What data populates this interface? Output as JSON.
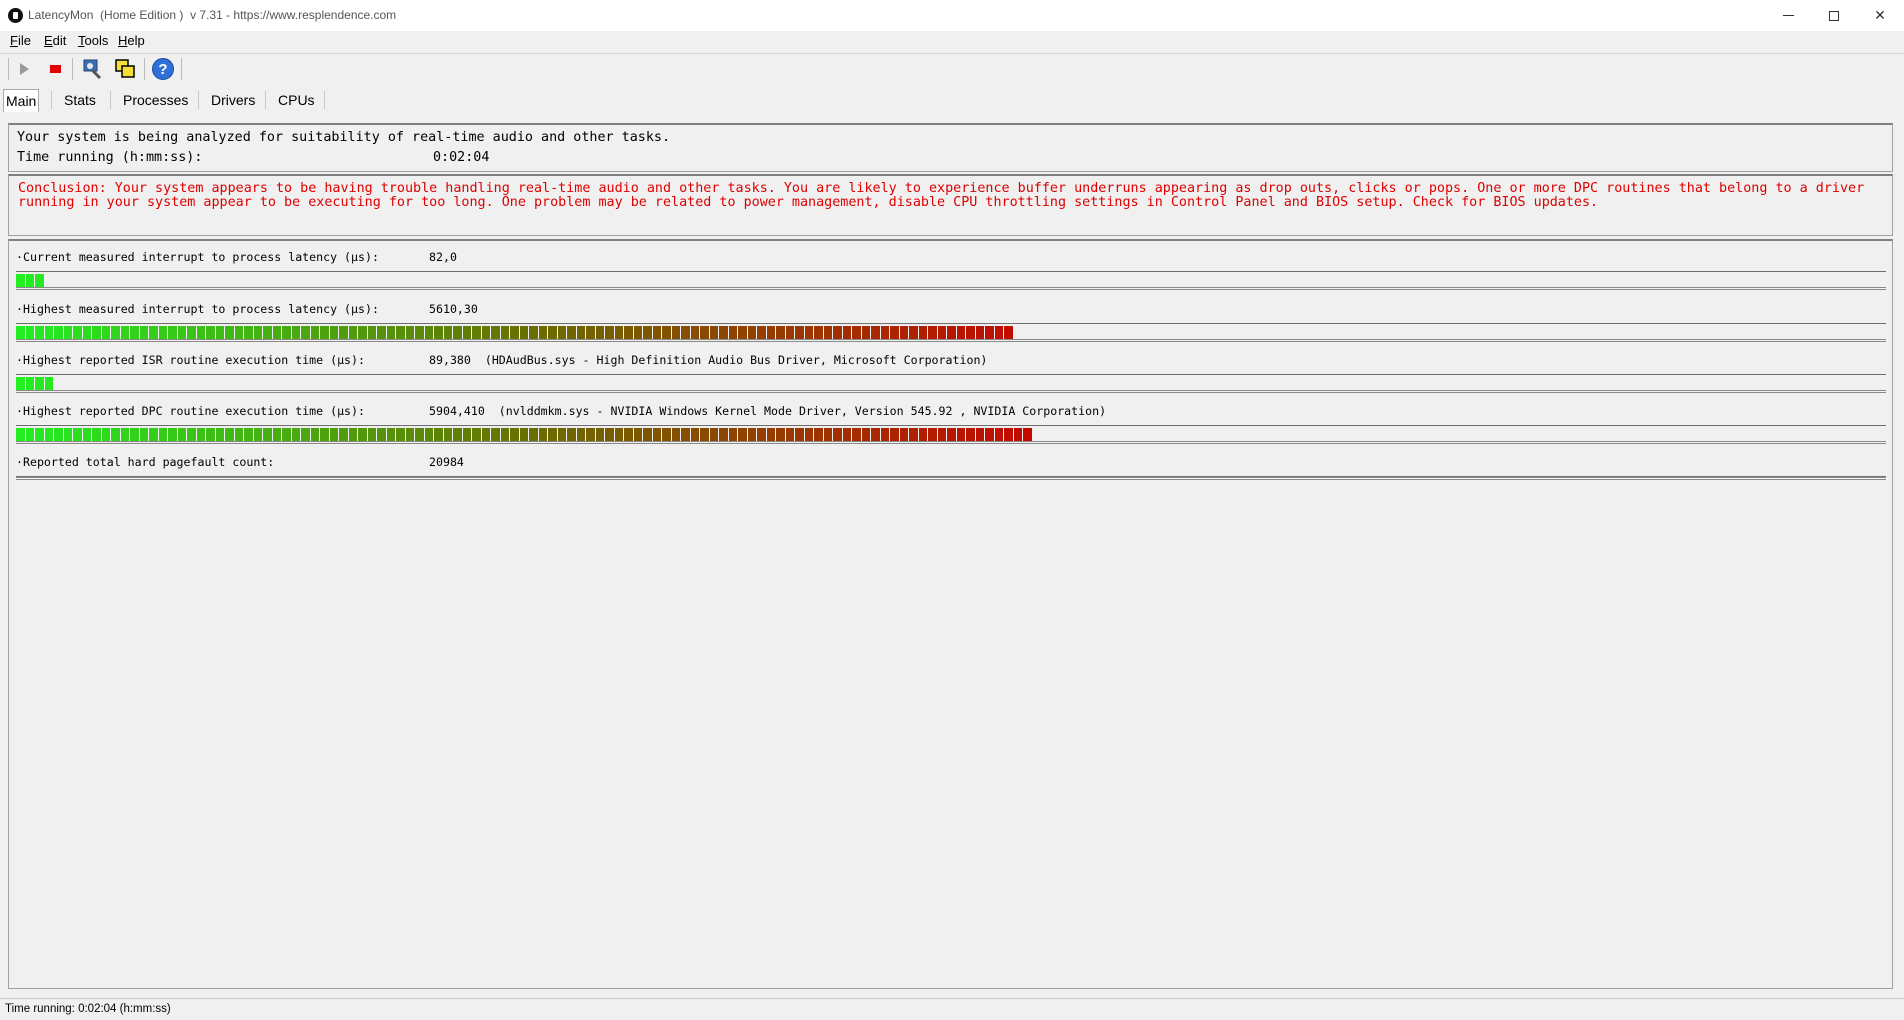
{
  "window": {
    "title": "LatencyMon  (Home Edition )  v 7.31 - https://www.resplendence.com"
  },
  "menu": {
    "items": [
      {
        "label": "File",
        "key": "F",
        "rest": "ile"
      },
      {
        "label": "Edit",
        "key": "E",
        "rest": "dit"
      },
      {
        "label": "Tools",
        "key": "T",
        "rest": "ools"
      },
      {
        "label": "Help",
        "key": "H",
        "rest": "elp"
      }
    ]
  },
  "toolbar": {
    "icons": [
      "play-icon",
      "stop-icon",
      "analyze-icon",
      "windows-icon",
      "help-icon"
    ]
  },
  "tabs": [
    {
      "label": "Main",
      "active": true
    },
    {
      "label": "Stats",
      "active": false
    },
    {
      "label": "Processes",
      "active": false
    },
    {
      "label": "Drivers",
      "active": false
    },
    {
      "label": "CPUs",
      "active": false
    }
  ],
  "status": {
    "analyzing_text": "Your system is being analyzed for suitability of real-time audio and other tasks.",
    "time_label": "Time running (h:mm:ss):",
    "time_value": "0:02:04"
  },
  "conclusion": {
    "text": "Conclusion: Your system appears to be having trouble handling real-time audio and other tasks. You are likely to experience buffer underruns appearing as drop outs, clicks or pops. One or more DPC routines that belong to a driver running in your system appear to be executing for too long. One problem may be related to power management, disable CPU throttling settings in Control Panel and BIOS setup. Check for BIOS updates.",
    "color": "#e00000"
  },
  "metrics": [
    {
      "label": "·Current measured interrupt to process latency (µs):",
      "value": "82,0",
      "level_segments": 3
    },
    {
      "label": "·Highest measured interrupt to process latency (µs):",
      "value": "5610,30",
      "level_segments": 105
    },
    {
      "label": "·Highest reported ISR routine execution time (µs):",
      "value": "89,380  (HDAudBus.sys - High Definition Audio Bus Driver, Microsoft Corporation)",
      "level_segments": 4
    },
    {
      "label": "·Highest reported DPC routine execution time (µs):",
      "value": "5904,410  (nvlddmkm.sys - NVIDIA Windows Kernel Mode Driver, Version 545.92 , NVIDIA Corporation)",
      "level_segments": 107
    },
    {
      "label": "·Reported total hard pagefault count:",
      "value": "20984"
    }
  ],
  "colors": {
    "bar_start": "#22ee22",
    "bar_mid": "#6b6b00",
    "bar_end": "#cc0000"
  },
  "statusbar": {
    "text": "Time running: 0:02:04  (h:mm:ss)"
  }
}
